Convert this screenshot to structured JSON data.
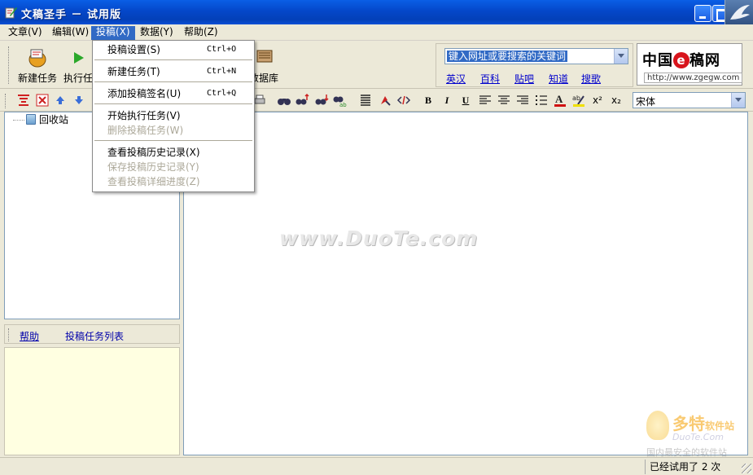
{
  "window": {
    "title": "文稿圣手 － 试用版"
  },
  "menubar": {
    "items": [
      {
        "label": "文章(V)"
      },
      {
        "label": "编辑(W)"
      },
      {
        "label": "投稿(X)"
      },
      {
        "label": "数据(Y)"
      },
      {
        "label": "帮助(Z)"
      }
    ]
  },
  "toolbar": {
    "new_task": "新建任务",
    "run_task": "执行任",
    "database": "数据库"
  },
  "search": {
    "placeholder": "键入网址或要搜索的关键词",
    "links": [
      "英汉",
      "百科",
      "贴吧",
      "知道",
      "搜歌"
    ]
  },
  "brand": {
    "name_left": "中国",
    "name_e": "e",
    "name_right": "稿网",
    "url": "http://www.zgegw.com"
  },
  "format_toolbar": {
    "bold": "B",
    "italic": "I",
    "underline": "U",
    "superscript": "x²",
    "subscript": "x₂",
    "font": "宋体"
  },
  "tree": {
    "items": [
      {
        "label": "回收站"
      }
    ]
  },
  "left_tabs": {
    "help": "帮助",
    "task_list": "投稿任务列表"
  },
  "watermark": {
    "text": "www.DuoTe.com",
    "logo_title": "多特",
    "logo_suffix": "软件站",
    "logo_url": "DuoTe.Com",
    "logo_slogan": "国内最安全的软件站"
  },
  "status": {
    "trial": "已经试用了 2 次"
  },
  "dropdown": {
    "items": [
      {
        "label": "投稿设置(S)",
        "shortcut": "Ctrl+O"
      },
      {
        "label": "新建任务(T)",
        "shortcut": "Ctrl+N"
      },
      {
        "label": "添加投稿签名(U)",
        "shortcut": "Ctrl+Q"
      },
      {
        "label": "开始执行任务(V)",
        "shortcut": ""
      },
      {
        "label": "删除投稿任务(W)",
        "shortcut": ""
      },
      {
        "label": "查看投稿历史记录(X)",
        "shortcut": ""
      },
      {
        "label": "保存投稿历史记录(Y)",
        "shortcut": ""
      },
      {
        "label": "查看投稿详细进度(Z)",
        "shortcut": ""
      }
    ]
  }
}
